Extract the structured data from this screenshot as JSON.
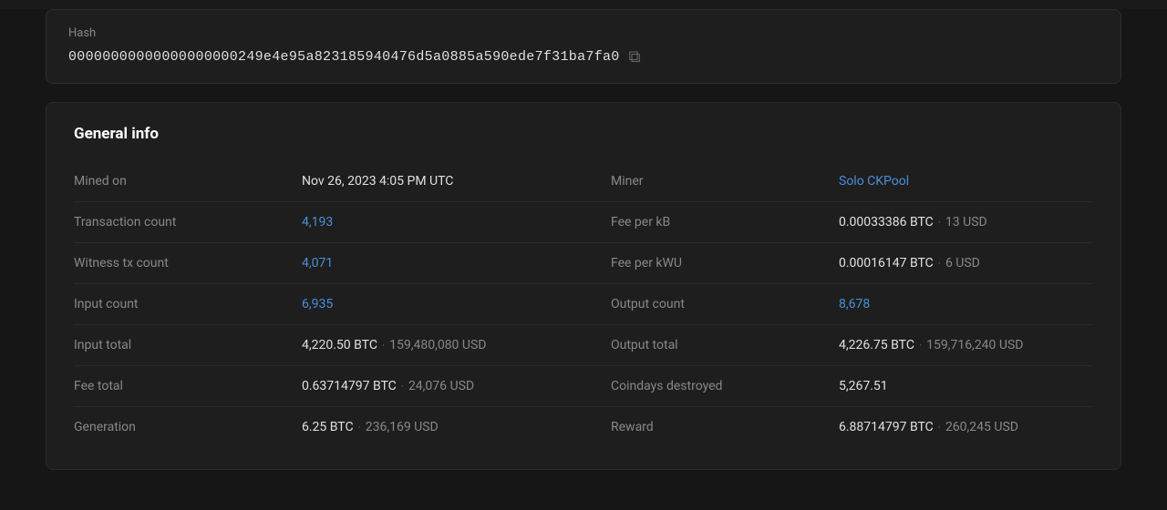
{
  "hash_section": {
    "label": "Hash",
    "value": "00000000000000000000249e4e95a823185940476d5a0885a590ede7f31ba7fa0",
    "copy_icon": "⧉"
  },
  "general_info": {
    "title": "General info",
    "rows": [
      {
        "left_label": "Mined on",
        "left_value": "Nov 26, 2023 4:05 PM UTC",
        "left_value_type": "plain",
        "right_label": "Miner",
        "right_value": "Solo CKPool",
        "right_value_type": "link"
      },
      {
        "left_label": "Transaction count",
        "left_value": "4,193",
        "left_value_type": "link",
        "right_label": "Fee per kB",
        "right_value": "0.00033386 BTC",
        "right_value_secondary": "13 USD",
        "right_value_type": "plain"
      },
      {
        "left_label": "Witness tx count",
        "left_value": "4,071",
        "left_value_type": "link",
        "right_label": "Fee per kWU",
        "right_value": "0.00016147 BTC",
        "right_value_secondary": "6 USD",
        "right_value_type": "plain"
      },
      {
        "left_label": "Input count",
        "left_value": "6,935",
        "left_value_type": "link",
        "right_label": "Output count",
        "right_value": "8,678",
        "right_value_type": "link"
      },
      {
        "left_label": "Input total",
        "left_value": "4,220.50 BTC",
        "left_value_secondary": "159,480,080 USD",
        "left_value_type": "plain",
        "right_label": "Output total",
        "right_value": "4,226.75 BTC",
        "right_value_secondary": "159,716,240 USD",
        "right_value_type": "plain"
      },
      {
        "left_label": "Fee total",
        "left_value": "0.63714797 BTC",
        "left_value_secondary": "24,076 USD",
        "left_value_type": "plain",
        "right_label": "Coindays destroyed",
        "right_value": "5,267.51",
        "right_value_type": "plain"
      },
      {
        "left_label": "Generation",
        "left_value": "6.25 BTC",
        "left_value_secondary": "236,169 USD",
        "left_value_type": "plain",
        "right_label": "Reward",
        "right_value": "6.88714797 BTC",
        "right_value_secondary": "260,245 USD",
        "right_value_type": "plain"
      }
    ]
  },
  "colors": {
    "link": "#4a90d9",
    "label": "#888888",
    "value": "#e0e0e0",
    "secondary": "#888888",
    "separator": "#666666"
  }
}
